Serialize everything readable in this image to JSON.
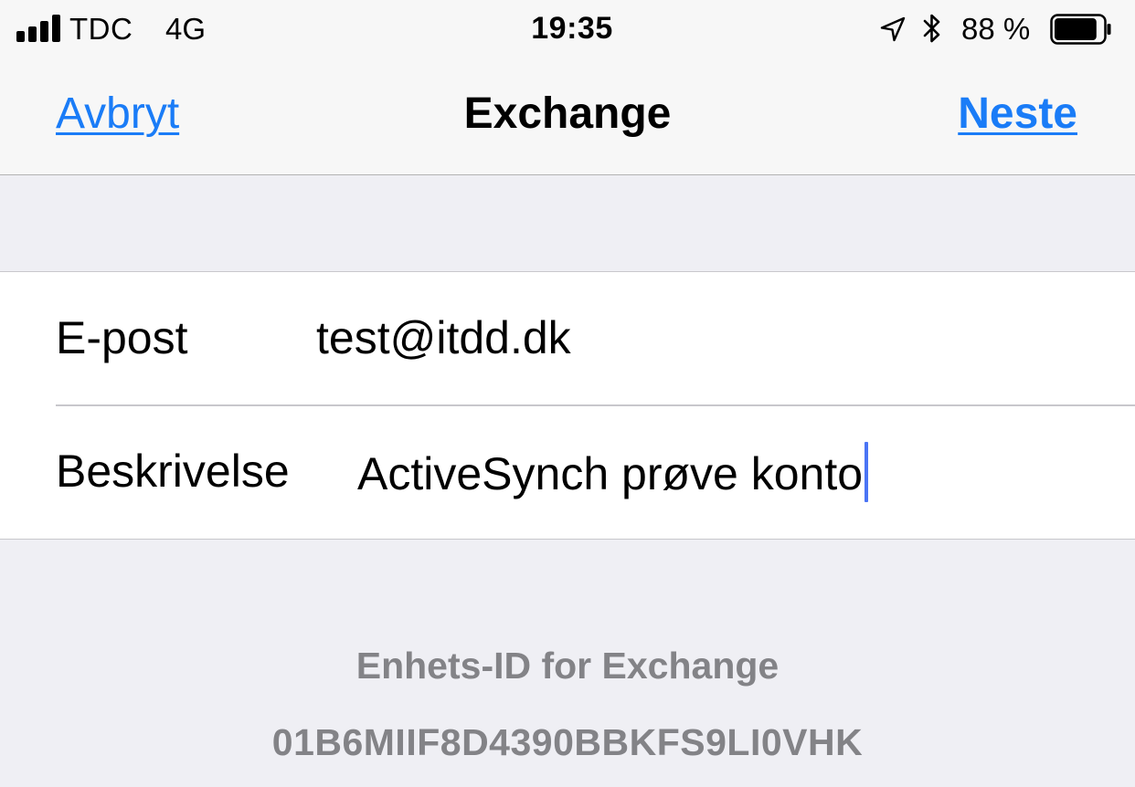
{
  "status_bar": {
    "carrier": "TDC",
    "network": "4G",
    "time": "19:35",
    "battery_percent": "88 %",
    "battery_level": 0.88,
    "signal_icon": "cellular-signal-icon",
    "location_icon": "location-arrow-icon",
    "bluetooth_icon": "bluetooth-icon",
    "battery_icon": "battery-icon"
  },
  "nav": {
    "cancel_label": "Avbryt",
    "title": "Exchange",
    "next_label": "Neste"
  },
  "form": {
    "email_label": "E-post",
    "email_value": "test@itdd.dk",
    "description_label": "Beskrivelse",
    "description_value": "ActiveSynch prøve konto"
  },
  "footer": {
    "device_id_label": "Enhets-ID for Exchange",
    "device_id_value": "01B6MIIF8D4390BBKFS9LI0VHK"
  },
  "colors": {
    "accent": "#1a7cf7",
    "caret": "#4a74f5",
    "background": "#efeff4",
    "bar_background": "#f7f7f7",
    "footer_text": "#838387"
  }
}
